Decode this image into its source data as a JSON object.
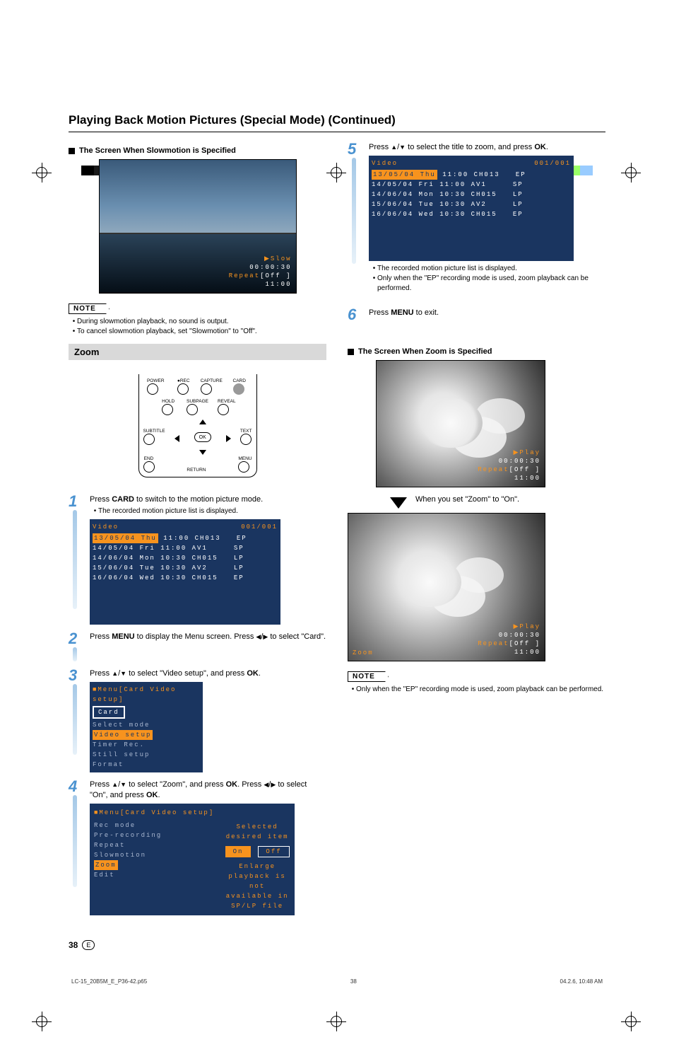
{
  "pageTitle": "Playing Back Motion Pictures (Special Mode) (Continued)",
  "leftCol": {
    "slowmotionHead": "The Screen When Slowmotion is Specified",
    "osdSlow": {
      "line1": "▶Slow",
      "time": "00:00:30",
      "repeat": "Repeat[Off ]",
      "clock": "11:00"
    },
    "noteLabel": "NOTE",
    "noteBullets": [
      "During slowmotion playback, no sound is output.",
      "To cancel slowmotion playback, set \"Slowmotion\" to \"Off\"."
    ],
    "sectionZoom": "Zoom",
    "remote": {
      "power": "POWER",
      "rec": "●REC",
      "capture": "CAPTURE",
      "card": "CARD",
      "hold": "HOLD",
      "subpage": "SUBPAGE",
      "reveal": "REVEAL",
      "subtitle": "SUBTITLE",
      "text": "TEXT",
      "end": "END",
      "menu": "MENU",
      "ok": "OK",
      "return": "RETURN"
    },
    "step1": {
      "text_a": "Press ",
      "text_b": "CARD",
      "text_c": " to switch to the motion picture mode.",
      "bullet": "The recorded motion picture list is displayed."
    },
    "video_list": {
      "title": "Video",
      "counter": "001/001",
      "rows": [
        {
          "date": "13/05/04",
          "day": "Thu",
          "time": "11:00",
          "ch": "CH013",
          "mode": "EP"
        },
        {
          "date": "14/05/04",
          "day": "Fri",
          "time": "11:00",
          "ch": "AV1",
          "mode": "SP"
        },
        {
          "date": "14/06/04",
          "day": "Mon",
          "time": "10:30",
          "ch": "CH015",
          "mode": "LP"
        },
        {
          "date": "15/06/04",
          "day": "Tue",
          "time": "10:30",
          "ch": "AV2",
          "mode": "LP"
        },
        {
          "date": "16/06/04",
          "day": "Wed",
          "time": "10:30",
          "ch": "CH015",
          "mode": "EP"
        }
      ]
    },
    "step2": {
      "text_a": "Press ",
      "text_b": "MENU",
      "text_c": " to display the Menu screen. Press ",
      "text_d": " to select \"Card\"."
    },
    "step3": {
      "text_a": "Press ",
      "text_b": " to select \"Video setup\", and press ",
      "text_c": "OK",
      "text_d": ".",
      "menu_title": "■Menu[Card Video setup]",
      "items": [
        "Card",
        "Select mode",
        "Video setup",
        "Timer Rec.",
        "Still setup",
        "Format"
      ]
    },
    "step4": {
      "text_a": "Press ",
      "text_b": " to select \"Zoom\", and press ",
      "text_c": "OK",
      "text_d": ". Press ",
      "text_e": " to select \"On\", and press ",
      "text_f": "OK",
      "text_g": ".",
      "menu_title": "■Menu[Card Video setup]",
      "left_items": [
        "Rec mode",
        "Pre-recording",
        "Repeat",
        "Slowmotion",
        "Zoom",
        "Edit"
      ],
      "right_prompt": "Selected desired item",
      "on": "On",
      "off": "Off",
      "hint1": "Enlarge playback is not",
      "hint2": "available in SP/LP file"
    }
  },
  "rightCol": {
    "step5": {
      "text_a": "Press ",
      "text_b": " to select the title to zoom, and press ",
      "text_c": "OK",
      "text_d": ".",
      "bullets": [
        "The recorded motion picture list is displayed.",
        "Only when the \"EP\" recording mode is used, zoom playback can be performed."
      ]
    },
    "step6": {
      "text_a": "Press ",
      "text_b": "MENU",
      "text_c": " to exit."
    },
    "zoomHead": "The Screen When Zoom is Specified",
    "osdPlay": {
      "line1": "▶Play",
      "time": "00:00:30",
      "repeat": "Repeat[Off ]",
      "clock": "11:00"
    },
    "zoomCaption": "When you set \"Zoom\" to \"On\".",
    "zoomLabel": "Zoom",
    "noteLabel": "NOTE",
    "noteBullets": [
      "Only when the \"EP\" recording mode is used, zoom playback can be performed."
    ]
  },
  "footer": {
    "pageNum": "38",
    "lang": "E",
    "file": "LC-15_20B5M_E_P36-42.p65",
    "filePage": "38",
    "timestamp": "04.2.6, 10:48 AM"
  }
}
